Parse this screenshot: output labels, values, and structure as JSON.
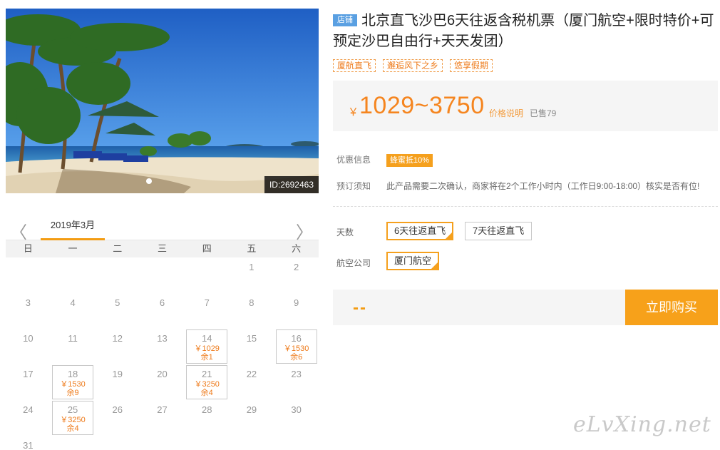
{
  "photo": {
    "id_label": "ID:2692463"
  },
  "calendar": {
    "month": "2019年3月",
    "prev_icon": "chevron-left-icon",
    "next_icon": "chevron-right-icon",
    "weekdays": [
      "日",
      "一",
      "二",
      "三",
      "四",
      "五",
      "六"
    ],
    "first_weekday_index": 5,
    "days": [
      {
        "num": "1"
      },
      {
        "num": "2"
      },
      {
        "num": "3"
      },
      {
        "num": "4"
      },
      {
        "num": "5"
      },
      {
        "num": "6"
      },
      {
        "num": "7"
      },
      {
        "num": "8"
      },
      {
        "num": "9"
      },
      {
        "num": "10"
      },
      {
        "num": "11"
      },
      {
        "num": "12"
      },
      {
        "num": "13"
      },
      {
        "num": "14",
        "price": "￥1029",
        "left": "余1"
      },
      {
        "num": "15"
      },
      {
        "num": "16",
        "price": "￥1530",
        "left": "余6"
      },
      {
        "num": "17"
      },
      {
        "num": "18",
        "price": "￥1530",
        "left": "余9"
      },
      {
        "num": "19"
      },
      {
        "num": "20"
      },
      {
        "num": "21",
        "price": "￥3250",
        "left": "余4"
      },
      {
        "num": "22"
      },
      {
        "num": "23"
      },
      {
        "num": "24"
      },
      {
        "num": "25",
        "price": "￥3250",
        "left": "余4"
      },
      {
        "num": "26"
      },
      {
        "num": "27"
      },
      {
        "num": "28"
      },
      {
        "num": "29"
      },
      {
        "num": "30"
      },
      {
        "num": "31"
      }
    ]
  },
  "product": {
    "shop_tag": "店铺",
    "title": "北京直飞沙巴6天往返含税机票（厦门航空+限时特价+可预定沙巴自由行+天天发团）",
    "tags": [
      "厦航直飞",
      "邂逅风下之乡",
      "悠享假期"
    ],
    "price_symbol": "￥",
    "price": "1029~3750",
    "price_explain": "价格说明",
    "sold": "已售79"
  },
  "info": {
    "discount_label": "优惠信息",
    "discount_badge": "蜂蜜抵10%",
    "notice_label": "预订须知",
    "notice_text": "此产品需要二次确认，商家将在2个工作小时内（工作日9:00-18:00）核实是否有位!"
  },
  "options": {
    "days_label": "天数",
    "days": [
      {
        "label": "6天往返直飞",
        "selected": true
      },
      {
        "label": "7天往返直飞",
        "selected": false
      }
    ],
    "airline_label": "航空公司",
    "airlines": [
      {
        "label": "厦门航空",
        "selected": true
      }
    ]
  },
  "purchase": {
    "total": "--",
    "buy_label": "立即购买"
  },
  "watermark": "eLvXing.net",
  "colors": {
    "accent": "#f5a01d",
    "price": "#f5851f",
    "shop_tag": "#5aa0e2"
  }
}
